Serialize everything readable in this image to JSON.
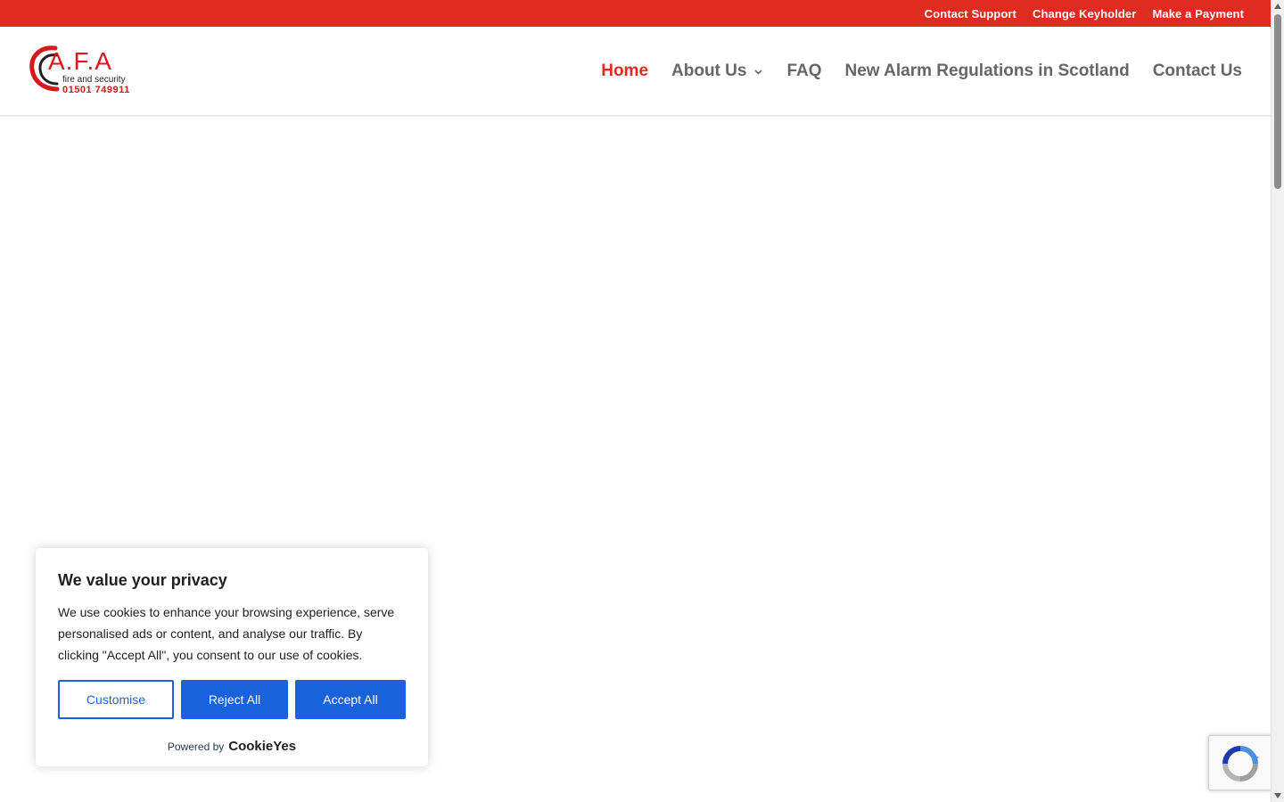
{
  "topbar": {
    "links": [
      "Contact Support",
      "Change Keyholder",
      "Make a Payment"
    ]
  },
  "logo": {
    "letters": "A.F.A",
    "tagline": "fire and security",
    "phone": "01501 749911"
  },
  "nav": {
    "items": [
      {
        "label": "Home",
        "active": true
      },
      {
        "label": "About Us",
        "has_submenu": true
      },
      {
        "label": "FAQ"
      },
      {
        "label": "New Alarm Regulations in Scotland"
      },
      {
        "label": "Contact Us"
      }
    ]
  },
  "cookie": {
    "title": "We value your privacy",
    "body": "We use cookies to enhance your browsing experience, serve personalised ads or content, and analyse our traffic. By clicking \"Accept All\", you consent to our use of cookies.",
    "customise_label": "Customise",
    "reject_label": "Reject All",
    "accept_label": "Accept All",
    "powered_by": "Powered by",
    "powered_brand": "CookieYes"
  },
  "colors": {
    "brand_red": "#e02b20",
    "logo_red": "#d7191e",
    "nav_text": "#666666",
    "cookie_blue": "#1863dc"
  },
  "icons": {
    "submenu": "chevron-down-icon",
    "recaptcha": "recaptcha-icon"
  }
}
